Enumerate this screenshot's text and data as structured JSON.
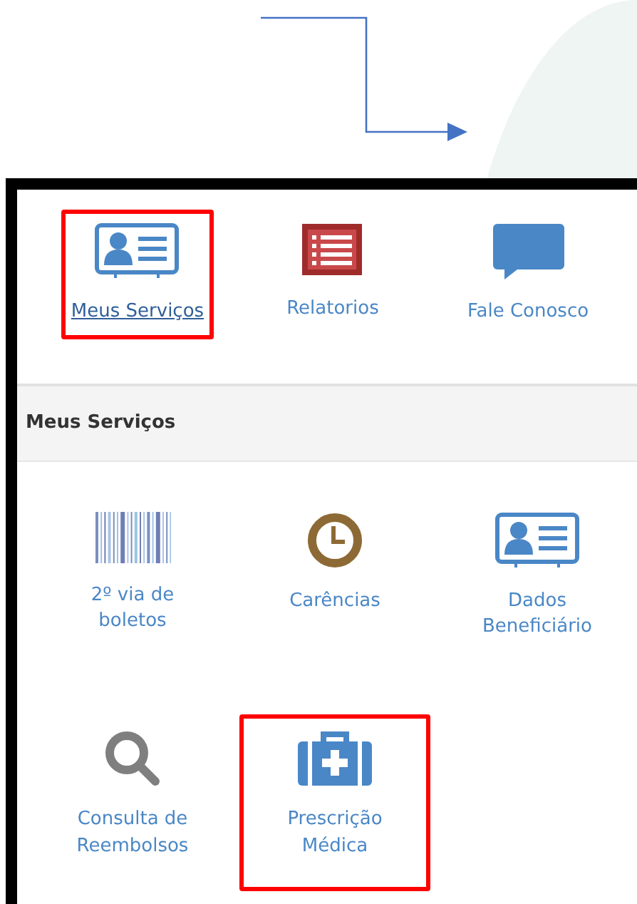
{
  "annotation_arrow": true,
  "top_menu": [
    {
      "label": "Meus Serviços",
      "kind": "id-card",
      "selected": true,
      "highlighted": true
    },
    {
      "label": "Relatorios",
      "kind": "list",
      "selected": false,
      "highlighted": false
    },
    {
      "label": "Fale Conosco",
      "kind": "chat",
      "selected": false,
      "highlighted": false
    }
  ],
  "section_title": "Meus Serviços",
  "services": [
    {
      "label": "2º via de boletos",
      "kind": "barcode",
      "highlighted": false
    },
    {
      "label": "Carências",
      "kind": "clock",
      "highlighted": false
    },
    {
      "label": "Dados Beneficiário",
      "kind": "id-card",
      "highlighted": false
    },
    {
      "label": "Consulta de Reembolsos",
      "kind": "search",
      "highlighted": false
    },
    {
      "label": "Prescrição Médica",
      "kind": "medkit",
      "highlighted": true
    }
  ]
}
